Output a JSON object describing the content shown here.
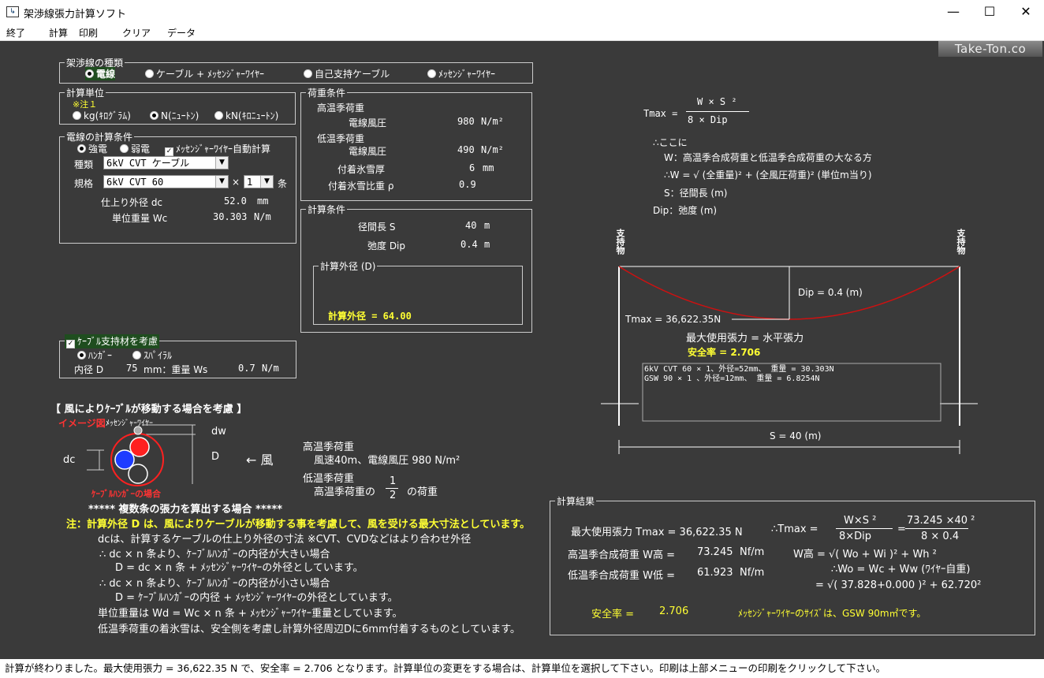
{
  "window": {
    "title": "架渉線張力計算ソフト",
    "minimize": "—",
    "maximize": "☐",
    "close": "✕"
  },
  "menu": [
    "終了",
    "計算",
    "印刷",
    "クリア",
    "データ"
  ],
  "logo": "Take-Ton.co",
  "wire_type": {
    "title": "架渉線の種類",
    "options": [
      "電線",
      "ケーブル + ﾒｯｾﾝｼﾞｬｰﾜｲﾔｰ",
      "自己支持ケーブル",
      "ﾒｯｾﾝｼﾞｬｰﾜｲﾔｰ"
    ],
    "selected": 0
  },
  "units": {
    "title": "計算単位",
    "note": "※注１",
    "options": [
      "kg(ｷﾛｸﾞﾗﾑ)",
      "N(ﾆｭｰﾄﾝ)",
      "kN(ｷﾛﾆｭｰﾄﾝ)"
    ],
    "selected": 1
  },
  "wire_calc": {
    "title": "電線の計算条件",
    "radio1": "強電",
    "radio2": "弱電",
    "auto_calc": "ﾒｯｾﾝｼﾞｬｰﾜｲﾔｰ自動計算",
    "type_label": "種類",
    "type_value": "6kV CVT ケーブル",
    "spec_label": "規格",
    "spec_value": "6kV CVT 60",
    "times": "×",
    "count": "1",
    "count_unit": "条",
    "od_label": "仕上り外径  dc",
    "od_value": "52.0",
    "od_unit": "mm",
    "wt_label": "単位重量  Wc",
    "wt_value": "30.303",
    "wt_unit": "N/m"
  },
  "load": {
    "title": "荷重条件",
    "high": "高温季荷重",
    "high_wind_label": "電線風圧",
    "high_wind_value": "980",
    "high_wind_unit": "N/m²",
    "low": "低温季荷重",
    "low_wind_label": "電線風圧",
    "low_wind_value": "490",
    "low_wind_unit": "N/m²",
    "ice_label": "付着氷雪厚",
    "ice_value": "6",
    "ice_unit": "mm",
    "ice_sg_label": "付着氷雪比重  ρ",
    "ice_sg_value": "0.9"
  },
  "calc": {
    "title": "計算条件",
    "span_label": "径間長  S",
    "span_value": "40",
    "span_unit": "m",
    "dip_label": "弛度  Dip",
    "dip_value": "0.4",
    "dip_unit": "m",
    "od_box_title": "計算外径 (D)",
    "od_result": "計算外径 = 64.00"
  },
  "support": {
    "title": "ｹｰﾌﾞﾙ支持材を考慮",
    "opt1": "ﾊﾝｶﾞｰ",
    "opt2": "ｽﾊﾟｲﾗﾙ",
    "inner_label": "内径 D",
    "inner_value": "75",
    "inner_unit": "mm：重量 Ws",
    "wt_value": "0.7",
    "wt_unit": "N/m"
  },
  "wind_section": {
    "title": "【 風によりｹｰﾌﾞﾙが移動する場合を考慮 】",
    "image_label": "イメージ図",
    "messenger": "ﾒｯｾﾝｼﾞｬｰﾜｲﾔｰ",
    "dw": "dw",
    "dc": "dc",
    "D": "D",
    "arrow": "←  風",
    "hanger": "ｹｰﾌﾞﾙﾊﾝｶﾞｰの場合",
    "high": "高温季荷重",
    "high_desc": "風速40m、電線風圧 980 N/m²",
    "low": "低温季荷重",
    "low_desc_pre": "高温季荷重の",
    "low_frac_n": "1",
    "low_frac_d": "2",
    "low_desc_post": "の荷重"
  },
  "notes": [
    "*****  複数条の張力を算出する場合  *****",
    "注：計算外径 D は、風によりケーブルが移動する事を考慮して、風を受ける最大寸法としています。",
    "dcは、計算するケーブルの仕上り外径の寸法 ※CVT、CVDなどはより合わせ外径",
    "∴ dc × n 条より、ｹｰﾌﾞﾙﾊﾝｶﾞｰの内径が大きい場合",
    "D = dc × n 条 + ﾒｯｾﾝｼﾞｬｰﾜｲﾔｰの外径としています。",
    "∴ dc × n 条より、ｹｰﾌﾞﾙﾊﾝｶﾞｰの内径が小さい場合",
    "D = ｹｰﾌﾞﾙﾊﾝｶﾞｰの内径 + ﾒｯｾﾝｼﾞｬｰﾜｲﾔｰの外径としています。",
    "単位重量は  Wd = Wc × n 条 + ﾒｯｾﾝｼﾞｬｰﾜｲﾔｰ重量としています。",
    "低温季荷重の着氷雪は、安全側を考慮し計算外径周辺Dに6mm付着するものとしています。"
  ],
  "formula": {
    "tmax": "Tmax =",
    "num": "W × S ²",
    "den": "8 × Dip",
    "where": "∴ここに",
    "w_desc": "W：高温季合成荷重と低温季合成荷重の大なる方",
    "w_eq": "∴W = √ (全重量)² + (全風圧荷重)²  (単位m当り)",
    "s_desc": "S：径間長 (m)",
    "dip_desc": "Dip：弛度 (m)"
  },
  "diagram": {
    "support_l": "支持物",
    "support_r": "支持物",
    "dip": "Dip = 0.4 (m)",
    "tmax": "Tmax = 36,622.35N",
    "max_tension": "最大使用張力 = 水平張力",
    "safety": "安全率 = 2.706",
    "box_line1": "6kV CVT 60 × 1、外径=52mm、 重量 = 30.303N",
    "box_line2": "GSW 90 × 1 、外径=12mm、 重量 = 6.8254N",
    "span": "S = 40 (m)"
  },
  "result": {
    "title": "計算結果",
    "tmax_label": "最大使用張力 Tmax = 36,622.35  N",
    "tmax_formula_label": "∴Tmax  =",
    "f1_num": "W×S ²",
    "f1_den": "8×Dip",
    "f2_num": "73.245 ×40 ²",
    "f2_den": "8  × 0.4",
    "whigh_label": "高温季合成荷重 W高 =",
    "whigh_value": "73.245",
    "whigh_unit": "Nf/m",
    "wlow_label": "低温季合成荷重 W低 =",
    "wlow_value": "61.923",
    "wlow_unit": "Nf/m",
    "whigh_eq": "W高 = √( Wo + Wi )² + Wh ²",
    "wo_eq": "∴Wo = Wc + Ww (ﾜｲﾔｰ自重)",
    "num_eq": "= √( 37.828+0.000 )² + 62.720²",
    "safety_label": "安全率 =",
    "safety_value": "2.706",
    "messenger": "ﾒｯｾﾝｼﾞｬｰﾜｲﾔｰのｻｲｽﾞは、GSW 90m㎡です。"
  },
  "status": "計算が終わりました。最大使用張力 = 36,622.35 N で、安全率 = 2.706 となります。計算単位の変更をする場合は、計算単位を選択して下さい。印刷は上部メニューの印刷をクリックして下さい。"
}
